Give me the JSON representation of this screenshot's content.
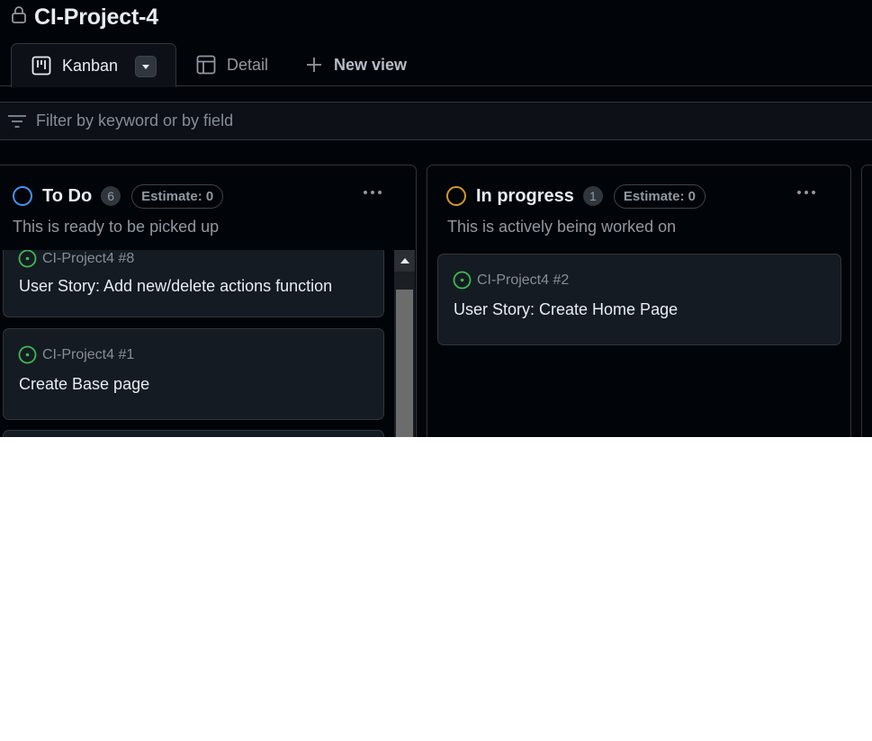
{
  "project": {
    "title": "CI-Project-4"
  },
  "tabs": [
    {
      "label": "Kanban"
    },
    {
      "label": "Detail"
    },
    {
      "label": "New view"
    }
  ],
  "filter": {
    "placeholder": "Filter by keyword or by field"
  },
  "columns": [
    {
      "name": "To Do",
      "count": "6",
      "estimate": "Estimate: 0",
      "description": "This is ready to be picked up",
      "status_color": "#4493f8",
      "cards": [
        {
          "ref": "CI-Project4 #8",
          "title": "User Story: Add new/delete actions function"
        },
        {
          "ref": "CI-Project4 #1",
          "title": "Create Base page"
        }
      ]
    },
    {
      "name": "In progress",
      "count": "1",
      "estimate": "Estimate: 0",
      "description": "This is actively being worked on",
      "status_color": "#d29922",
      "cards": [
        {
          "ref": "CI-Project4 #2",
          "title": "User Story: Create Home Page"
        }
      ]
    }
  ],
  "colors": {
    "open_issue": "#3fb950",
    "background": "#010409",
    "card": "#151b23",
    "border": "#30363d"
  }
}
